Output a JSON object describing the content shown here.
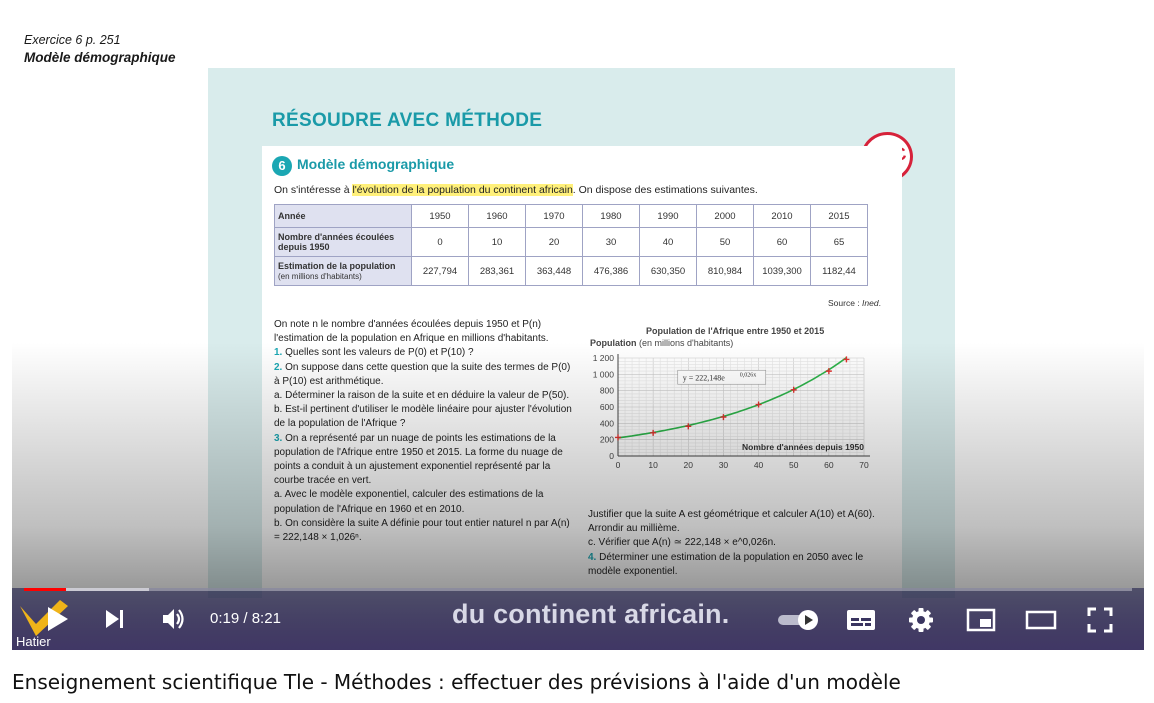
{
  "exercise": {
    "ref": "Exercice 6 p. 251",
    "name": "Modèle démographique"
  },
  "page": {
    "banner": "RÉSOUDRE AVEC MÉTHODE",
    "bac_badge": "BAC",
    "number": "6",
    "title": "Modèle démographique",
    "intro_before": "On s'intéresse à ",
    "intro_highlight": "l'évolution de la population du continent africain",
    "intro_after": ". On dispose des estimations suivantes.",
    "table": {
      "row_headers": [
        "Année",
        "Nombre d'années écoulées depuis 1950",
        "Estimation de la population"
      ],
      "row3_sub": "(en millions d'habitants)",
      "years": [
        "1950",
        "1960",
        "1970",
        "1980",
        "1990",
        "2000",
        "2010",
        "2015"
      ],
      "elapsed": [
        "0",
        "10",
        "20",
        "30",
        "40",
        "50",
        "60",
        "65"
      ],
      "population": [
        "227,794",
        "283,361",
        "363,448",
        "476,386",
        "630,350",
        "810,984",
        "1039,300",
        "1182,44"
      ]
    },
    "source_label": "Source : ",
    "source_name": "Ined",
    "left_text": {
      "p1": "On note n le nombre d'années écoulées depuis 1950 et P(n) l'estimation de la population en Afrique en millions d'habitants.",
      "q1_num": "1.",
      "q1": "Quelles sont les valeurs de P(0) et P(10) ?",
      "q2_num": "2.",
      "q2": "On suppose dans cette question que la suite des termes de P(0) à P(10) est arithmétique.",
      "q2a": "a. Déterminer la raison de la suite et en déduire la valeur de P(50).",
      "q2b": "b. Est-il pertinent d'utiliser le modèle linéaire pour ajuster l'évolution de la population de l'Afrique ?",
      "q3_num": "3.",
      "q3": "On a représenté par un nuage de points les estimations de la population de l'Afrique entre 1950 et 2015. La forme du nuage de points a conduit à un ajustement exponentiel représenté par la courbe tracée en vert.",
      "q3a": "a. Avec le modèle exponentiel, calculer des estimations de la population de l'Afrique en 1960 et en 2010.",
      "q3b": "b. On considère la suite A définie pour tout entier naturel n par A(n) = 222,148 × 1,026ⁿ."
    },
    "right_text": {
      "p1": "Justifier que la suite A est géométrique et calculer A(10) et A(60). Arrondir au millième.",
      "q3c": "c. Vérifier que A(n) ≃ 222,148 × e^0,026n.",
      "q4_num": "4.",
      "q4": "Déterminer une estimation de la population en 2050 avec le modèle exponentiel."
    }
  },
  "chart_data": {
    "type": "scatter",
    "title": "Population de l'Afrique entre 1950 et 2015",
    "ylabel": "Population",
    "ylabel_unit": "(en millions d'habitants)",
    "xlabel": "Nombre d'années depuis 1950",
    "xlim": [
      0,
      70
    ],
    "ylim": [
      0,
      1200
    ],
    "xticks": [
      0,
      10,
      20,
      30,
      40,
      50,
      60,
      70
    ],
    "yticks": [
      0,
      200,
      400,
      600,
      800,
      1000,
      1200
    ],
    "ytick_labels": [
      "0",
      "200",
      "400",
      "600",
      "800",
      "1 000",
      "1 200"
    ],
    "grid": true,
    "points": {
      "x": [
        0,
        10,
        20,
        30,
        40,
        50,
        60,
        65
      ],
      "y": [
        227.794,
        283.361,
        363.448,
        476.386,
        630.35,
        810.984,
        1039.3,
        1182.44
      ]
    },
    "fit": {
      "a": 222.148,
      "k": 0.026,
      "label": "y = 222,148e",
      "label_exp": "0,026x"
    },
    "colors": {
      "points": "#e0322f",
      "fit": "#2db34a"
    }
  },
  "player": {
    "time_current": "0:19",
    "time_total": "8:21",
    "time_separator": " / ",
    "caption": "du continent africain.",
    "progress_fraction": 0.038,
    "logo_text": "Hatier",
    "controls": [
      "play-icon",
      "next-icon",
      "volume-icon",
      "autoplay-toggle",
      "subtitles-icon",
      "settings-icon",
      "miniplayer-icon",
      "theater-icon",
      "fullscreen-icon"
    ]
  },
  "video_title": "Enseignement scientifique Tle - Méthodes : effectuer des prévisions à l'aide d'un modèle"
}
